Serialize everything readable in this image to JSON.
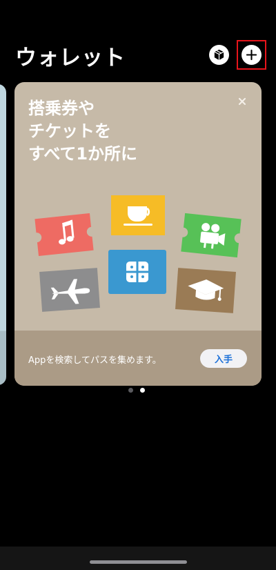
{
  "header": {
    "title": "ウォレット"
  },
  "card": {
    "title": "搭乗券や\nチケットを\nすべて1か所に",
    "footer_text": "Appを検索してパスを集めます。",
    "get_label": "入手",
    "background": "#c6baa8",
    "footer_background": "#ab9b86"
  },
  "ticket_colors": {
    "music": "#ee6b63",
    "coffee": "#f6bc26",
    "movie": "#57c157",
    "flight": "#8d8d8e",
    "gift": "#3a98d0",
    "education": "#9a7b55"
  },
  "pager": {
    "count": 2,
    "active_index": 1
  }
}
